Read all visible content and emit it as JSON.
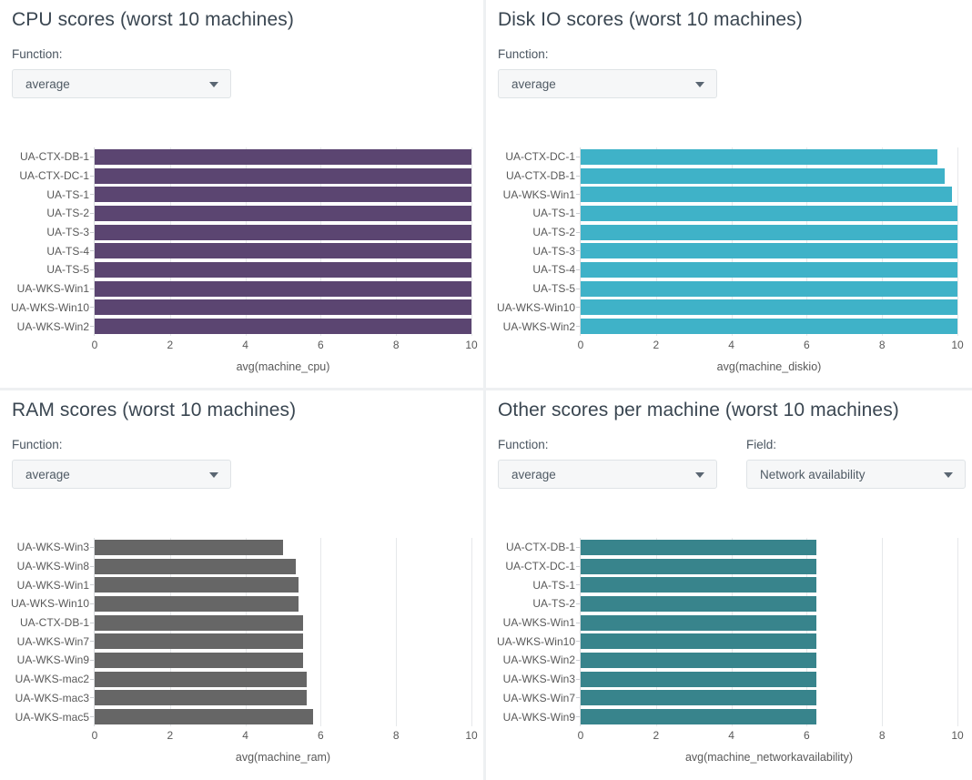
{
  "panels": [
    {
      "title": "CPU scores (worst 10 machines)",
      "function_label": "Function:",
      "function_value": "average",
      "color": "#5b4571",
      "chart_data": {
        "type": "bar",
        "orientation": "horizontal",
        "title": "CPU scores (worst 10 machines)",
        "xlabel": "avg(machine_cpu)",
        "ylabel": "",
        "xlim": [
          0,
          10
        ],
        "xticks": [
          0,
          2,
          4,
          6,
          8,
          10
        ],
        "grid": true,
        "legend": "none",
        "categories": [
          "UA-CTX-DB-1",
          "UA-CTX-DC-1",
          "UA-TS-1",
          "UA-TS-2",
          "UA-TS-3",
          "UA-TS-4",
          "UA-TS-5",
          "UA-WKS-Win1",
          "UA-WKS-Win10",
          "UA-WKS-Win2"
        ],
        "values": [
          10,
          10,
          10,
          10,
          10,
          10,
          10,
          10,
          10,
          10
        ]
      }
    },
    {
      "title": "Disk IO scores (worst 10 machines)",
      "function_label": "Function:",
      "function_value": "average",
      "color": "#3fb2c8",
      "chart_data": {
        "type": "bar",
        "orientation": "horizontal",
        "title": "Disk IO scores (worst 10 machines)",
        "xlabel": "avg(machine_diskio)",
        "ylabel": "",
        "xlim": [
          0,
          10
        ],
        "xticks": [
          0,
          2,
          4,
          6,
          8,
          10
        ],
        "grid": true,
        "legend": "none",
        "categories": [
          "UA-CTX-DC-1",
          "UA-CTX-DB-1",
          "UA-WKS-Win1",
          "UA-TS-1",
          "UA-TS-2",
          "UA-TS-3",
          "UA-TS-4",
          "UA-TS-5",
          "UA-WKS-Win10",
          "UA-WKS-Win2"
        ],
        "values": [
          9.47,
          9.66,
          9.85,
          10,
          10,
          10,
          10,
          10,
          10,
          10
        ]
      }
    },
    {
      "title": "RAM scores (worst 10 machines)",
      "function_label": "Function:",
      "function_value": "average",
      "color": "#666666",
      "chart_data": {
        "type": "bar",
        "orientation": "horizontal",
        "title": "RAM scores (worst 10 machines)",
        "xlabel": "avg(machine_ram)",
        "ylabel": "",
        "xlim": [
          0,
          10
        ],
        "xticks": [
          0,
          2,
          4,
          6,
          8,
          10
        ],
        "grid": true,
        "legend": "none",
        "categories": [
          "UA-WKS-Win3",
          "UA-WKS-Win8",
          "UA-WKS-Win1",
          "UA-WKS-Win10",
          "UA-CTX-DB-1",
          "UA-WKS-Win7",
          "UA-WKS-Win9",
          "UA-WKS-mac2",
          "UA-WKS-mac3",
          "UA-WKS-mac5"
        ],
        "values": [
          5.0,
          5.35,
          5.4,
          5.4,
          5.52,
          5.52,
          5.52,
          5.64,
          5.64,
          5.79
        ]
      }
    },
    {
      "title": "Other scores per machine (worst 10 machines)",
      "function_label": "Function:",
      "function_value": "average",
      "field_label": "Field:",
      "field_value": "Network availability",
      "color": "#38848c",
      "chart_data": {
        "type": "bar",
        "orientation": "horizontal",
        "title": "Other scores per machine (worst 10 machines)",
        "xlabel": "avg(machine_networkavailability)",
        "ylabel": "",
        "xlim": [
          0,
          10
        ],
        "xticks": [
          0,
          2,
          4,
          6,
          8,
          10
        ],
        "grid": true,
        "legend": "none",
        "categories": [
          "UA-CTX-DB-1",
          "UA-CTX-DC-1",
          "UA-TS-1",
          "UA-TS-2",
          "UA-WKS-Win1",
          "UA-WKS-Win10",
          "UA-WKS-Win2",
          "UA-WKS-Win3",
          "UA-WKS-Win7",
          "UA-WKS-Win9"
        ],
        "values": [
          6.25,
          6.25,
          6.25,
          6.25,
          6.25,
          6.25,
          6.25,
          6.25,
          6.25,
          6.25
        ]
      }
    }
  ],
  "icons": {
    "dropdown_arrow": "chevron-down-icon"
  }
}
